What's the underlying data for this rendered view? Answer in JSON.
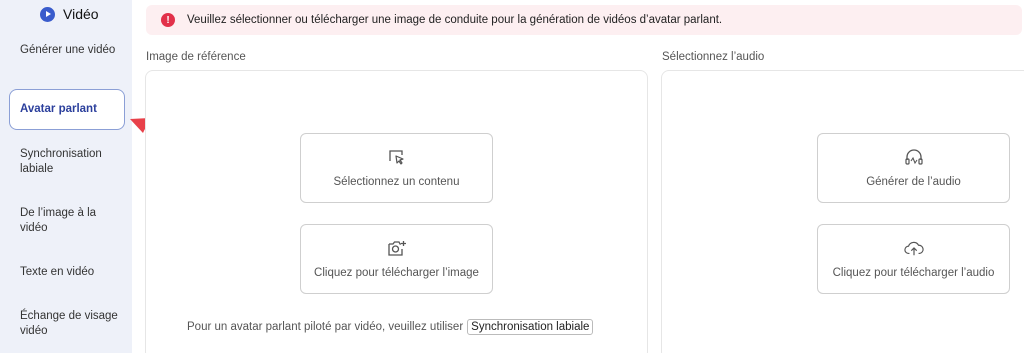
{
  "sidebar": {
    "title": "Vidéo",
    "items": [
      {
        "label": "Générer une vidéo"
      },
      {
        "label": "Avatar parlant"
      },
      {
        "label": "Synchronisation labiale"
      },
      {
        "label": "De l’image à la vidéo"
      },
      {
        "label": "Texte en vidéo"
      },
      {
        "label": "Échange de visage vidéo"
      }
    ]
  },
  "alert": {
    "icon": "alert-icon",
    "text": "Veuillez sélectionner ou télécharger une image de conduite pour la génération de vidéos d’avatar parlant."
  },
  "reference": {
    "label": "Image de référence",
    "select_label": "Sélectionnez un contenu",
    "upload_label": "Cliquez pour télécharger l’image",
    "note_text": "Pour un avatar parlant piloté par vidéo, veuillez utiliser",
    "note_link": "Synchronisation labiale"
  },
  "audio": {
    "label": "Sélectionnez l’audio",
    "generate_label": "Générer de l’audio",
    "upload_label": "Cliquez pour télécharger l’audio"
  },
  "colors": {
    "accent": "#3a5ccc",
    "active_text": "#2b3f9c",
    "alert_bg": "#fdeff1",
    "alert_icon": "#e2314a",
    "arrow": "#e8414a"
  }
}
